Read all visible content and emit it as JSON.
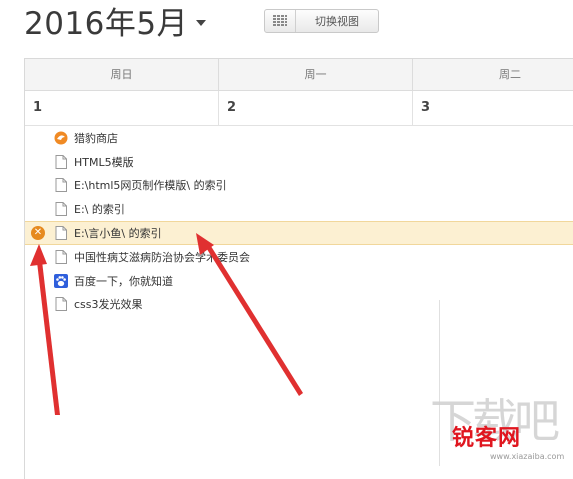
{
  "header": {
    "month_title": "2016年5月",
    "switch_view_label": "切换视图"
  },
  "calendar": {
    "weekdays": [
      "周日",
      "周一",
      "周二"
    ],
    "dates": [
      "1",
      "2",
      "3"
    ]
  },
  "bookmarks": [
    {
      "title": "猎豹商店",
      "icon": "cheetah-store-icon"
    },
    {
      "title": "HTML5模版",
      "icon": "page-icon"
    },
    {
      "title": "E:\\html5网页制作模版\\ 的索引",
      "icon": "page-icon"
    },
    {
      "title": "E:\\ 的索引",
      "icon": "page-icon"
    },
    {
      "title": "E:\\言小鱼\\ 的索引",
      "icon": "page-icon",
      "selected": true
    },
    {
      "title": "中国性病艾滋病防治协会学术委员会",
      "icon": "page-icon"
    },
    {
      "title": "百度一下，你就知道",
      "icon": "baidu-paw-icon"
    },
    {
      "title": "css3发光效果",
      "icon": "page-icon"
    }
  ],
  "watermark": {
    "big": "下载吧",
    "brand": "锐客网",
    "url": "www.xiazaiba.com"
  },
  "colors": {
    "selected_row_bg": "#fcf0d2",
    "delete_button": "#e68a1f",
    "arrow": "#e03030",
    "brand": "#e0161f"
  }
}
